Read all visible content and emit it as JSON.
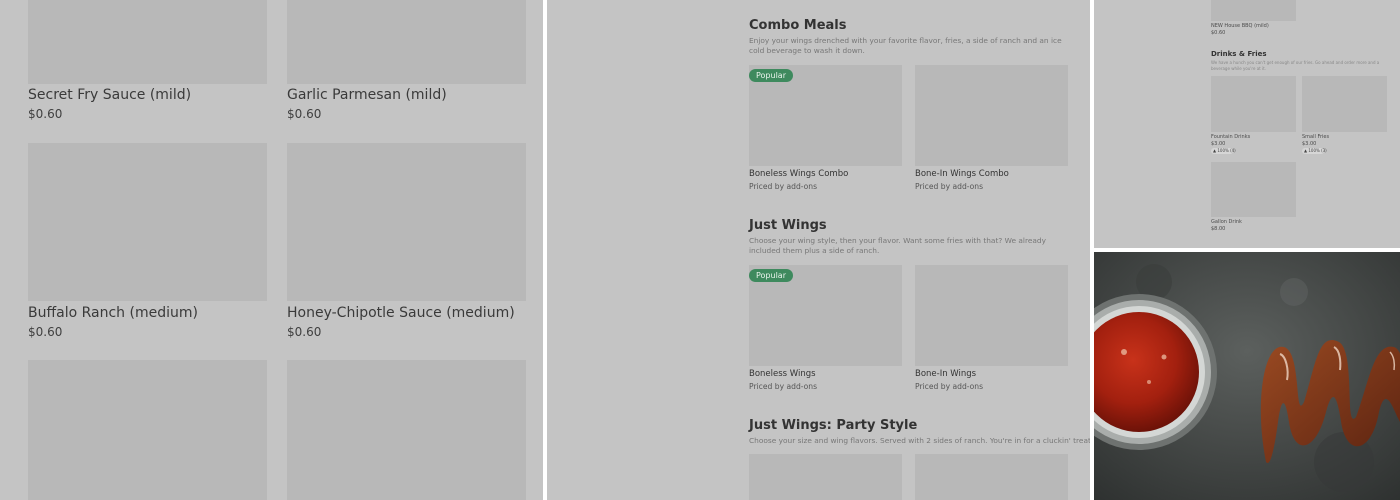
{
  "panel_left": {
    "items": [
      {
        "name": "Secret Fry Sauce (mild)",
        "price": "$0.60"
      },
      {
        "name": "Garlic Parmesan (mild)",
        "price": "$0.60"
      },
      {
        "name": "Buffalo Ranch (medium)",
        "price": "$0.60"
      },
      {
        "name": "Honey-Chipotle Sauce (medium)",
        "price": "$0.60"
      }
    ]
  },
  "panel_middle": {
    "sections": [
      {
        "title": "Combo Meals",
        "description": "Enjoy your wings drenched with your favorite flavor, fries, a side of ranch and an ice cold beverage to wash it down.",
        "items": [
          {
            "name": "Boneless Wings Combo",
            "sub": "Priced by add-ons",
            "badge": "Popular"
          },
          {
            "name": "Bone-In Wings Combo",
            "sub": "Priced by add-ons"
          }
        ]
      },
      {
        "title": "Just Wings",
        "description": "Choose your wing style, then your flavor. Want some fries with that? We already included them plus a side of ranch.",
        "items": [
          {
            "name": "Boneless Wings",
            "sub": "Priced by add-ons",
            "badge": "Popular"
          },
          {
            "name": "Bone-In Wings",
            "sub": "Priced by add-ons"
          }
        ]
      },
      {
        "title": "Just Wings: Party Style",
        "description": "Choose your size and wing flavors. Served with 2 sides of ranch. You're in for a cluckin' treat!"
      }
    ]
  },
  "panel_right": {
    "top_item": {
      "name": "NEW House BBQ (mild)",
      "price": "$0.60"
    },
    "section_title": "Drinks & Fries",
    "section_desc": "We have a hunch you can't get enough of our fries. Go ahead and order more and a beverage while you're at it.",
    "items": [
      {
        "name": "Fountain Drinks",
        "price": "$3.00",
        "rating": "100% (4)"
      },
      {
        "name": "Small Fries",
        "price": "$3.00",
        "rating": "100% (3)"
      },
      {
        "name": "Gallon Drink",
        "price": "$8.00"
      }
    ]
  },
  "photo": {
    "icon": "sauce-photo-image"
  }
}
